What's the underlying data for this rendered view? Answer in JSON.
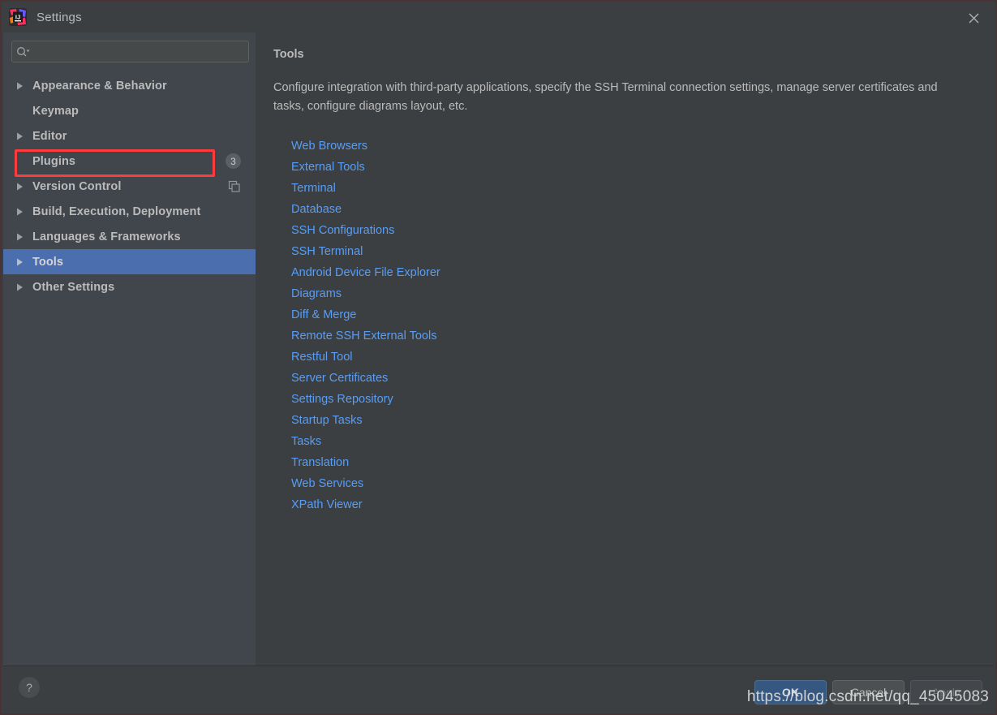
{
  "window": {
    "title": "Settings",
    "app_icon": "intellij-idea-icon",
    "close_icon": "close-icon"
  },
  "search": {
    "icon": "search-icon",
    "value": "",
    "placeholder": ""
  },
  "sidebar": {
    "items": [
      {
        "label": "Appearance & Behavior",
        "expandable": true,
        "selected": false,
        "badge": null,
        "trailing_icon": null
      },
      {
        "label": "Keymap",
        "expandable": false,
        "selected": false,
        "badge": null,
        "trailing_icon": null
      },
      {
        "label": "Editor",
        "expandable": true,
        "selected": false,
        "badge": null,
        "trailing_icon": null
      },
      {
        "label": "Plugins",
        "expandable": false,
        "selected": false,
        "badge": "3",
        "trailing_icon": null
      },
      {
        "label": "Version Control",
        "expandable": true,
        "selected": false,
        "badge": null,
        "trailing_icon": "copy-icon"
      },
      {
        "label": "Build, Execution, Deployment",
        "expandable": true,
        "selected": false,
        "badge": null,
        "trailing_icon": null
      },
      {
        "label": "Languages & Frameworks",
        "expandable": true,
        "selected": false,
        "badge": null,
        "trailing_icon": null
      },
      {
        "label": "Tools",
        "expandable": true,
        "selected": true,
        "badge": null,
        "trailing_icon": null
      },
      {
        "label": "Other Settings",
        "expandable": true,
        "selected": false,
        "badge": null,
        "trailing_icon": null
      }
    ],
    "annotation": {
      "target": "Plugins",
      "color": "#ff3b3b"
    }
  },
  "main": {
    "title": "Tools",
    "description": "Configure integration with third-party applications, specify the SSH Terminal connection settings, manage server certificates and tasks, configure diagrams layout, etc.",
    "links": [
      "Web Browsers",
      "External Tools",
      "Terminal",
      "Database",
      "SSH Configurations",
      "SSH Terminal",
      "Android Device File Explorer",
      "Diagrams",
      "Diff & Merge",
      "Remote SSH External Tools",
      "Restful Tool",
      "Server Certificates",
      "Settings Repository",
      "Startup Tasks",
      "Tasks",
      "Translation",
      "Web Services",
      "XPath Viewer"
    ]
  },
  "footer": {
    "help_label": "?",
    "help_icon": "question-mark-icon",
    "buttons": [
      {
        "label": "OK",
        "style": "primary",
        "disabled": false
      },
      {
        "label": "Cancel",
        "style": "normal",
        "disabled": false
      },
      {
        "label": "Apply",
        "style": "disabled",
        "disabled": true
      }
    ]
  },
  "watermark": {
    "text": "https://blog.csdn.net/qq_45045083"
  },
  "colors": {
    "window_bg": "#3c3f41",
    "sidebar_bg": "#41454c",
    "selection": "#4b6eaf",
    "link": "#589df6",
    "text": "#bbbbbb",
    "accent_primary": "#365880",
    "annotation": "#ff3b3b"
  }
}
